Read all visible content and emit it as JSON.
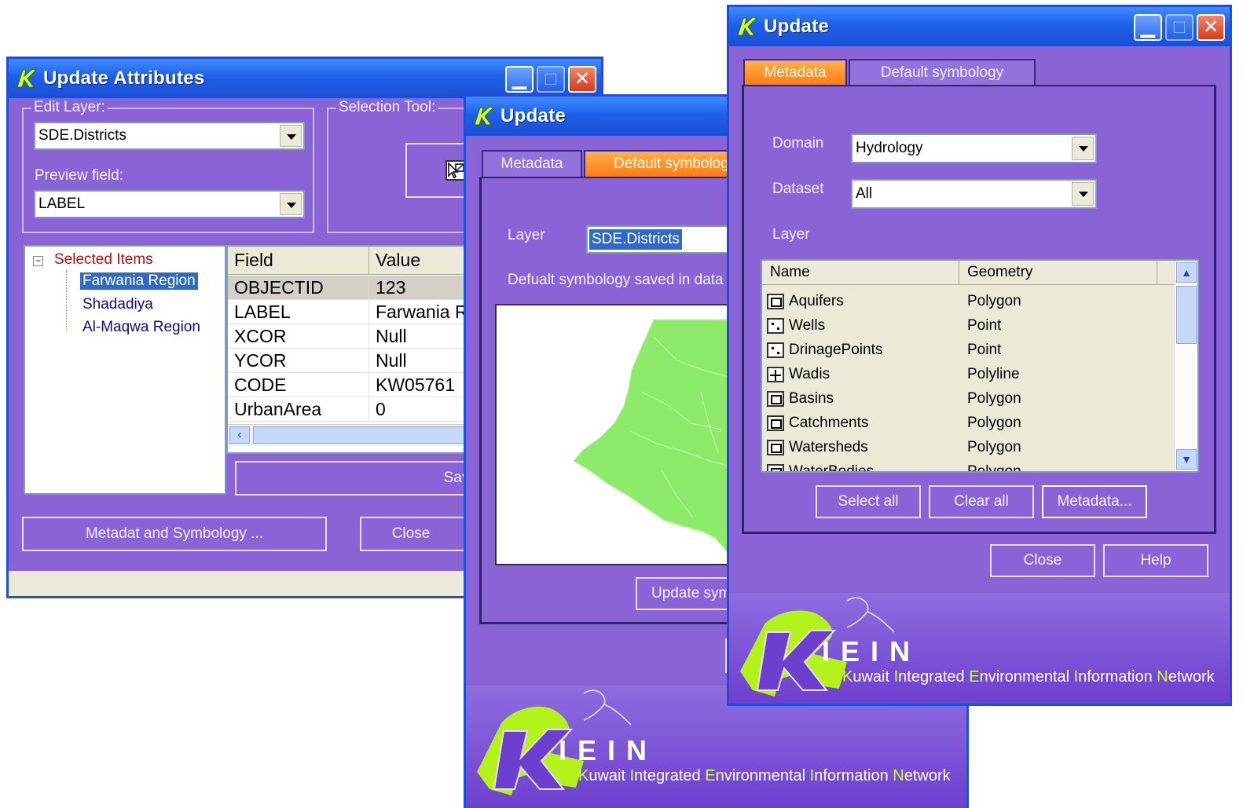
{
  "update_attributes": {
    "title": "Update Attributes",
    "edit_layer_label": "Edit Layer:",
    "edit_layer_value": "SDE.Districts",
    "preview_field_label": "Preview field:",
    "preview_field_value": "LABEL",
    "selection_tool_label": "Selection Tool:",
    "tree": {
      "root": "Selected Items",
      "items": [
        "Farwania Region",
        "Shadadiya",
        "Al-Maqwa Region"
      ]
    },
    "grid": {
      "columns": [
        "Field",
        "Value"
      ],
      "rows": [
        [
          "OBJECTID",
          "123"
        ],
        [
          "LABEL",
          "Farwania R"
        ],
        [
          "XCOR",
          "Null"
        ],
        [
          "YCOR",
          "Null"
        ],
        [
          "CODE",
          "KW05761"
        ],
        [
          "UrbanArea",
          "0"
        ]
      ]
    },
    "save_edits": "Save edits",
    "metadata_button": "Metadat and Symbology ...",
    "close": "Close"
  },
  "update_mid": {
    "title": "Update",
    "tabs": [
      "Metadata",
      "Default symbolog"
    ],
    "layer_label": "Layer",
    "layer_value": "SDE.Districts",
    "info_text": "Defualt symbology saved in data",
    "update_button": "Update sym",
    "brand_name": "IEIN",
    "tagline": [
      "K",
      "uwait ",
      "I",
      "ntegrated ",
      "E",
      "nvironmental ",
      "I",
      "nformation ",
      "N",
      "etwork"
    ]
  },
  "update_front": {
    "title": "Update",
    "tabs": [
      "Metadata",
      "Default symbology"
    ],
    "domain_label": "Domain",
    "domain_value": "Hydrology",
    "dataset_label": "Dataset",
    "dataset_value": "All",
    "layer_label": "Layer",
    "columns": [
      "Name",
      "Geometry"
    ],
    "layers": [
      {
        "name": "Aquifers",
        "geometry": "Polygon",
        "icon": "polygon-icon"
      },
      {
        "name": "Wells",
        "geometry": "Point",
        "icon": "point-icon"
      },
      {
        "name": "DrinagePoints",
        "geometry": "Point",
        "icon": "point-icon"
      },
      {
        "name": "Wadis",
        "geometry": "Polyline",
        "icon": "polyline-icon"
      },
      {
        "name": "Basins",
        "geometry": "Polygon",
        "icon": "polygon-icon"
      },
      {
        "name": "Catchments",
        "geometry": "Polygon",
        "icon": "polygon-icon"
      },
      {
        "name": "Watersheds",
        "geometry": "Polygon",
        "icon": "polygon-icon"
      },
      {
        "name": "WaterBodies",
        "geometry": "Polygon",
        "icon": "polygon-icon"
      }
    ],
    "select_all": "Select all",
    "clear_all": "Clear all",
    "metadata": "Metadata...",
    "close": "Close",
    "help": "Help",
    "brand_name": "IEIN",
    "tagline": [
      "K",
      "uwait ",
      "I",
      "ntegrated ",
      "E",
      "nvironmental ",
      "I",
      "nformation ",
      "N",
      "etwork"
    ]
  },
  "colors": {
    "window_bg": "#8a63d6",
    "titlebar": "#1f5fe8",
    "active_tab": "#ff7b13",
    "map_fill": "#8eea6a",
    "brand_accent": "#c9ff3a"
  }
}
